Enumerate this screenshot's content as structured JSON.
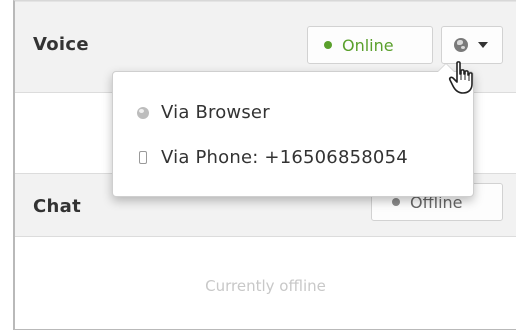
{
  "voice": {
    "title": "Voice",
    "status_label": "Online",
    "status_color": "#5aa02c",
    "mode_icon": "globe-icon"
  },
  "dropdown": {
    "items": [
      {
        "icon": "globe-icon",
        "label": "Via Browser"
      },
      {
        "icon": "phone-icon",
        "label": "Via Phone: +16506858054"
      }
    ]
  },
  "chat": {
    "title": "Chat",
    "status_label": "Offline",
    "empty_text": "Currently offline"
  },
  "cursor": "hand-pointer-icon"
}
